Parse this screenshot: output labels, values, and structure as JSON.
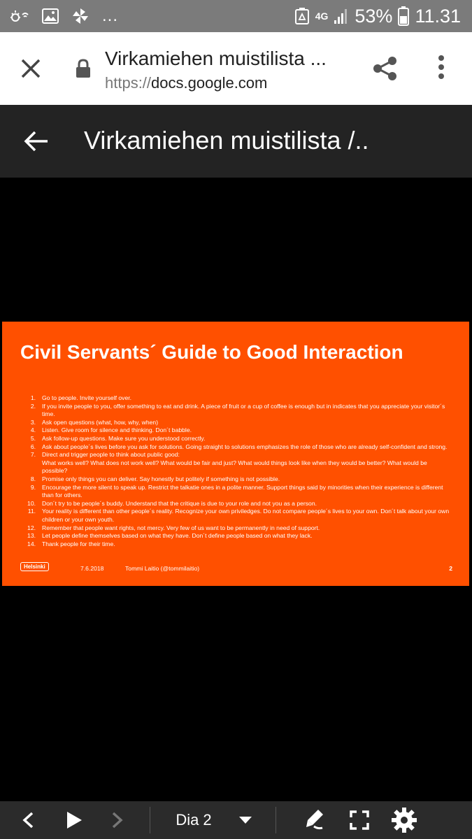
{
  "status_bar": {
    "network": "4G",
    "battery_percent": "53%",
    "time": "11.31",
    "overflow": "..."
  },
  "tab_bar": {
    "title": "Virkamiehen muistilista ...",
    "url_scheme": "https://",
    "url_host": "docs.google.com"
  },
  "app_bar": {
    "title": "Virkamiehen muistilista /.."
  },
  "slide": {
    "title": "Civil Servants´ Guide to Good Interaction",
    "items": [
      {
        "num": "1.",
        "text": "Go to people. Invite yourself over."
      },
      {
        "num": "2.",
        "text": "If you invite people to you, offer something to eat and drink. A piece of fruit or a cup of coffee is enough but in indicates that you appreciate your visitor´s time."
      },
      {
        "num": "3.",
        "text": "Ask open questions (what, how, why, when)"
      },
      {
        "num": "4.",
        "text": "Listen. Give room for silence and thinking. Don´t babble."
      },
      {
        "num": "5.",
        "text": "Ask follow-up questions. Make sure you understood correctly."
      },
      {
        "num": "6.",
        "text": "Ask about people´s lives before you ask for solutions. Going straight to solutions emphasizes the role of those who are already self-confident and strong."
      },
      {
        "num": "7.",
        "text": "Direct and trigger people to think about public good:"
      },
      {
        "num": "",
        "text": "What works well? What does not work well? What would be fair and just? What would things look like when they would be better? What would be possible?"
      },
      {
        "num": "8.",
        "text": "Promise only things you can deliver. Say honestly but politely if something is not possible."
      },
      {
        "num": "9.",
        "text": "Encourage the more silent to speak up. Restrict the talkatie ones in a polite manner. Support things said by minorities when their experience is different than for others."
      },
      {
        "num": "10.",
        "text": "Don´t try to be people´s buddy. Understand that the critique is due to your role and not you as a person."
      },
      {
        "num": "11.",
        "text": "Your reality is different than other people´s reality. Recognize your own priviledges. Do not compare people´s lives to your own. Don´t talk about your own children or your own youth."
      },
      {
        "num": "12.",
        "text": "Remember that people want rights, not mercy. Very few of us want to be permanently in need of support."
      },
      {
        "num": "13.",
        "text": "Let people define themselves based on what they have. Don´t define people based on what they lack."
      },
      {
        "num": "14.",
        "text": "Thank people for their time."
      }
    ],
    "footer": {
      "logo": "Helsinki",
      "date": "7.6.2018",
      "author": "Tommi Laitio (@tommilaitio)",
      "page": "2"
    },
    "background_color": "#ff5000"
  },
  "bottom_bar": {
    "slide_label": "Dia 2"
  },
  "icons": [
    "wifi-calling-icon",
    "gallery-icon",
    "pinwheel-icon",
    "recycle-icon",
    "signal-icon",
    "battery-icon",
    "close-icon",
    "lock-icon",
    "share-icon",
    "more-vert-icon",
    "back-arrow-icon",
    "prev-icon",
    "play-icon",
    "next-icon",
    "dropdown-icon",
    "pen-icon",
    "fullscreen-icon",
    "settings-icon"
  ]
}
